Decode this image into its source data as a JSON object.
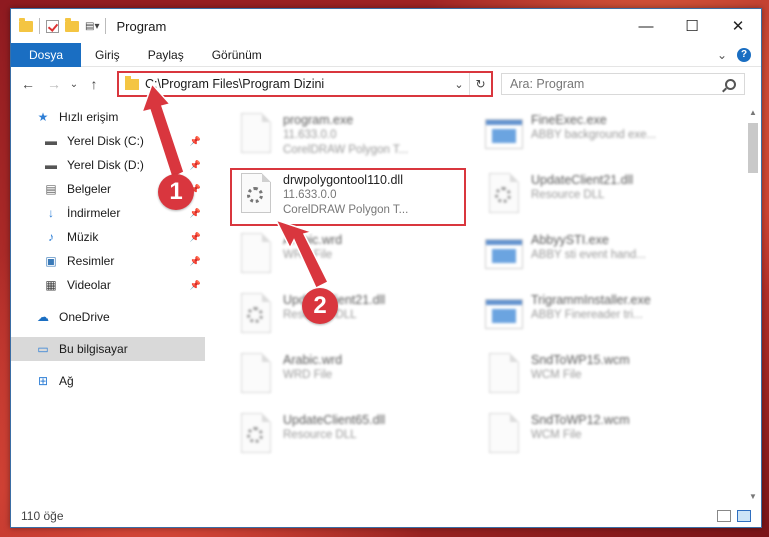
{
  "window": {
    "title": "Program",
    "controls": {
      "minimize": "—",
      "maximize": "☐",
      "close": "✕"
    }
  },
  "ribbon": {
    "tabs": [
      "Dosya",
      "Giriş",
      "Paylaş",
      "Görünüm"
    ],
    "help": "?",
    "expand": "⌄"
  },
  "navigation": {
    "back": "←",
    "forward": "→",
    "recent": "⌄",
    "up": "↑"
  },
  "address": {
    "path": "C:\\Program Files\\Program Dizini",
    "dropdown": "⌄",
    "refresh": "↻"
  },
  "search": {
    "placeholder": "Ara: Program"
  },
  "sidebar": {
    "quick_access": "Hızlı erişim",
    "items": [
      {
        "label": "Yerel Disk (C:)",
        "icon": "drive-icon"
      },
      {
        "label": "Yerel Disk (D:)",
        "icon": "drive-icon"
      },
      {
        "label": "Belgeler",
        "icon": "documents-icon"
      },
      {
        "label": "İndirmeler",
        "icon": "download-icon"
      },
      {
        "label": "Müzik",
        "icon": "music-icon"
      },
      {
        "label": "Resimler",
        "icon": "pictures-icon"
      },
      {
        "label": "Videolar",
        "icon": "video-icon"
      }
    ],
    "onedrive": "OneDrive",
    "this_pc": "Bu bilgisayar",
    "network": "Ağ"
  },
  "files": [
    {
      "name": "program.exe",
      "line2": "11.633.0.0",
      "line3": "CorelDRAW Polygon T...",
      "type": "exe",
      "blurred": true
    },
    {
      "name": "FineExec.exe",
      "line2": "ABBY background exe...",
      "line3": "",
      "type": "exe",
      "blurred": true
    },
    {
      "name": "drwpolygontool110.dll",
      "line2": "11.633.0.0",
      "line3": "CorelDRAW Polygon T...",
      "type": "dll",
      "blurred": false
    },
    {
      "name": "UpdateClient21.dll",
      "line2": "Resource DLL",
      "line3": "",
      "type": "dll",
      "blurred": true
    },
    {
      "name": "Arabic.wrd",
      "line2": "WRD File",
      "line3": "",
      "type": "doc",
      "blurred": true
    },
    {
      "name": "AbbyySTI.exe",
      "line2": "ABBY sti event hand...",
      "line3": "",
      "type": "exe",
      "blurred": true
    },
    {
      "name": "UpdateClient21.dll",
      "line2": "Resource DLL",
      "line3": "",
      "type": "dll",
      "blurred": true
    },
    {
      "name": "TrigrammInstaller.exe",
      "line2": "ABBY Finereader tri...",
      "line3": "",
      "type": "exe",
      "blurred": true
    },
    {
      "name": "Arabic.wrd",
      "line2": "WRD File",
      "line3": "",
      "type": "doc",
      "blurred": true
    },
    {
      "name": "SndToWP15.wcm",
      "line2": "WCM File",
      "line3": "",
      "type": "doc",
      "blurred": true
    },
    {
      "name": "UpdateClient65.dll",
      "line2": "Resource DLL",
      "line3": "",
      "type": "dll",
      "blurred": true
    },
    {
      "name": "SndToWP12.wcm",
      "line2": "WCM File",
      "line3": "",
      "type": "doc",
      "blurred": true
    }
  ],
  "status": {
    "count": "110 öğe"
  },
  "callouts": {
    "one": "1",
    "two": "2"
  },
  "colors": {
    "accent": "#1a6ec2",
    "callout": "#d9363e"
  }
}
